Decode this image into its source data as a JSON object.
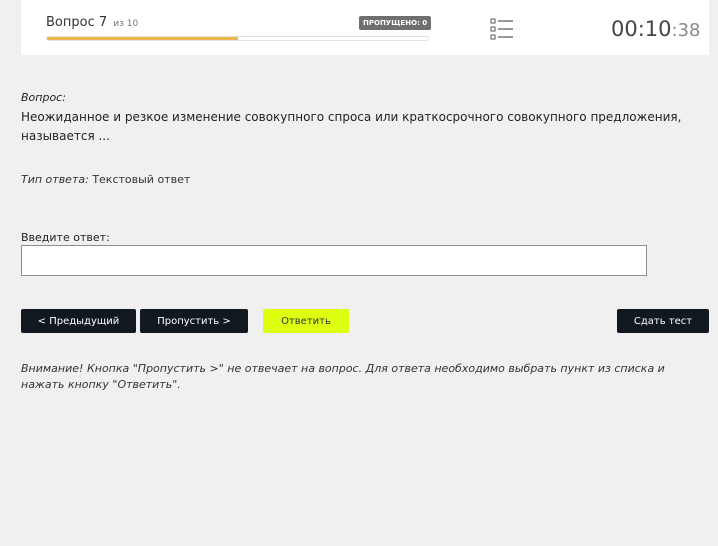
{
  "header": {
    "question_label": "Вопрос 7",
    "question_of": "из 10",
    "skipped_badge": "ПРОПУЩЕНО: 0",
    "progress": 0.5,
    "timer_main": "00:10",
    "timer_sec": "38",
    "list_icon": "list-icon"
  },
  "question": {
    "label": "Вопрос:",
    "text": "Неожиданное и резкое изменение совокупного спроса или краткосрочного совокупного предложения, называется ..."
  },
  "answer_type": {
    "label": "Тип ответа:",
    "value": "Текстовый ответ"
  },
  "answer_input": {
    "label": "Введите ответ:",
    "value": ""
  },
  "buttons": {
    "prev": "< Предыдущий",
    "skip": "Пропустить >",
    "answer": "Ответить",
    "finish": "Сдать тест"
  },
  "notice": "Внимание! Кнопка \"Пропустить >\" не отвечает на вопрос. Для ответа необходимо выбрать пункт из списка и нажать кнопку \"Ответить\".",
  "colors": {
    "progress": "#e9b54e",
    "answer_button": "#dfff12",
    "dark_button": "#11181f"
  }
}
